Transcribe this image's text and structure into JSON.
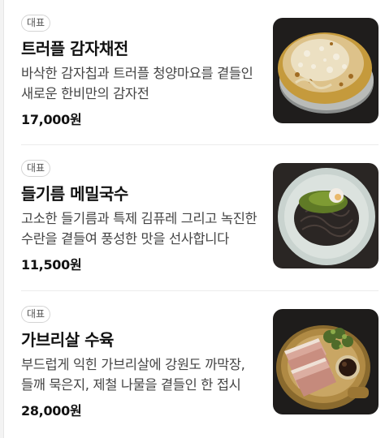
{
  "menu": {
    "items": [
      {
        "badge": "대표",
        "name": "트러플 감자채전",
        "description": "바삭한 감자칩과 트러플 청양마요를 곁들인 새로운 한비만의 감자전",
        "price": "17,000원",
        "image_icon": "truffle-potato-pancake-photo"
      },
      {
        "badge": "대표",
        "name": "들기름 메밀국수",
        "description": "고소한 들기름과 특제 김퓨레 그리고 녹진한 수란을 곁들여 풍성한 맛을 선사합니다",
        "price": "11,500원",
        "image_icon": "perilla-buckwheat-noodle-photo"
      },
      {
        "badge": "대표",
        "name": "가브리살 수육",
        "description": "부드럽게 익힌 가브리살에 강원도 까막장, 들깨 묵은지, 제철 나물을 곁들인 한 접시",
        "price": "28,000원",
        "image_icon": "pork-suyuk-photo"
      }
    ]
  }
}
